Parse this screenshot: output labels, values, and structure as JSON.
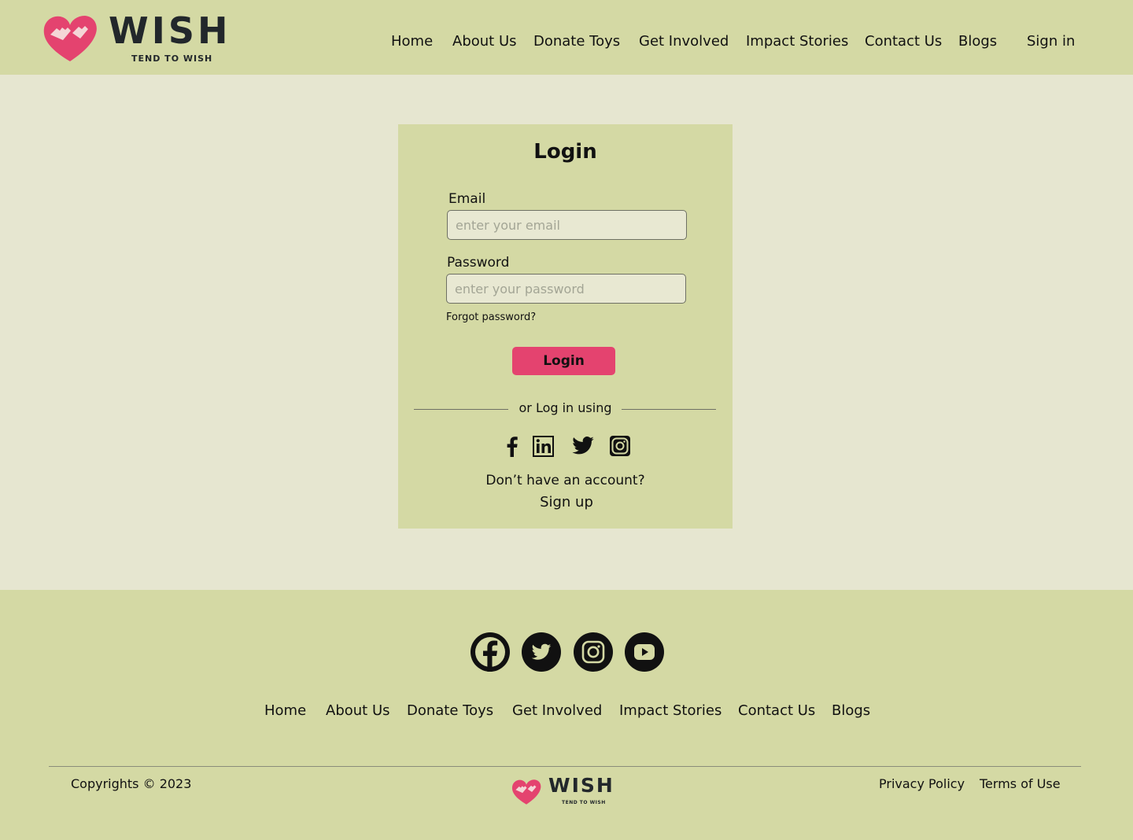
{
  "brand": {
    "name": "WISH",
    "tagline": "TEND TO WISH",
    "heart_color": "#e4436f",
    "text_color": "#22272b"
  },
  "header": {
    "nav": [
      "Home",
      "About Us",
      "Donate Toys",
      "Get Involved",
      "Impact Stories",
      "Contact Us",
      "Blogs"
    ],
    "sign_in": "Sign in"
  },
  "login": {
    "title": "Login",
    "email_label": "Email",
    "email_placeholder": "enter your email",
    "email_value": "",
    "password_label": "Password",
    "password_placeholder": "enter your password",
    "password_value": "",
    "forgot": "Forgot password?",
    "button": "Login",
    "divider": "or Log in using",
    "social_icons": [
      "facebook-icon",
      "linkedin-icon",
      "twitter-icon",
      "instagram-icon"
    ],
    "no_account": "Don’t have an account?",
    "signup": "Sign up"
  },
  "footer": {
    "social_icons": [
      "facebook-icon",
      "twitter-icon",
      "instagram-icon",
      "youtube-icon"
    ],
    "nav": [
      "Home",
      "About Us",
      "Donate Toys",
      "Get Involved",
      "Impact Stories",
      "Contact Us",
      "Blogs"
    ],
    "copyright": "Copyrights © 2023",
    "privacy": "Privacy Policy",
    "terms": "Terms of Use"
  },
  "colors": {
    "header_bg": "#d4d9a4",
    "page_bg": "#e6e6d0",
    "accent": "#e4436f"
  }
}
